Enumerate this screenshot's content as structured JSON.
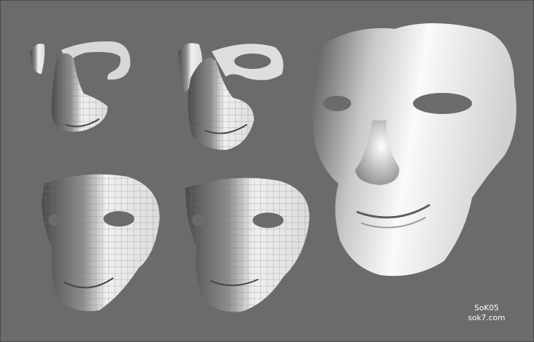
{
  "credits": {
    "name": "SoK05",
    "site": "sok7.com"
  },
  "colors": {
    "background": "#6b6b6b",
    "surface_light": "#f4f4f4",
    "surface_shadow": "#4e4e4e",
    "wire": "#8a8a8a"
  },
  "stages": [
    "wireframe-stage-1",
    "wireframe-stage-2",
    "wireframe-stage-3",
    "wireframe-stage-4",
    "final-smooth-mask"
  ]
}
